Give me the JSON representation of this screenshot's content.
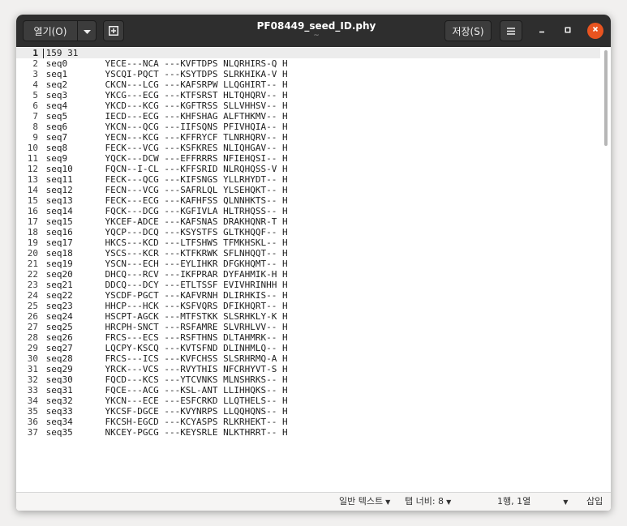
{
  "window": {
    "title": "PF08449_seed_ID.phy",
    "subtitle": "~"
  },
  "toolbar": {
    "open_label": "열기(O)",
    "open_arrow_icon": "chevron-down-icon",
    "new_tab_icon": "new-tab-icon",
    "save_label": "저장(S)",
    "menu_icon": "hamburger-menu-icon",
    "minimize_icon": "minimize-icon",
    "maximize_icon": "maximize-icon",
    "close_icon": "close-icon",
    "close_color": "#e95420"
  },
  "editor": {
    "current_line": 1,
    "lines": [
      {
        "num": "1",
        "text": "159 31"
      },
      {
        "num": "2",
        "text": "seq0       YECE---NCA ---KVFTDPS NLQRHIRS-Q H"
      },
      {
        "num": "3",
        "text": "seq1       YSCQI-PQCT ---KSYTDPS SLRKHIKA-V H"
      },
      {
        "num": "4",
        "text": "seq2       CKCN---LCG ---KAFSRPW LLQGHIRT-- H"
      },
      {
        "num": "5",
        "text": "seq3       YKCG---ECG ---KTFSRST HLTQHQRV-- H"
      },
      {
        "num": "6",
        "text": "seq4       YKCD---KCG ---KGFTRSS SLLVHHSV-- H"
      },
      {
        "num": "7",
        "text": "seq5       IECD---ECG ---KHFSHAG ALFTHKMV-- H"
      },
      {
        "num": "8",
        "text": "seq6       YKCN---QCG ---IIFSQNS PFIVHQIA-- H"
      },
      {
        "num": "9",
        "text": "seq7       YECN---KCG ---KFFRYCF TLNRHQRV-- H"
      },
      {
        "num": "10",
        "text": "seq8       FECK---VCG ---KSFKRES NLIQHGAV-- H"
      },
      {
        "num": "11",
        "text": "seq9       YQCK---DCW ---EFFRRRS NFIEHQSI-- H"
      },
      {
        "num": "12",
        "text": "seq10      FQCN--I-CL ---KFFSRID NLRQHQSS-V H"
      },
      {
        "num": "13",
        "text": "seq11      FECK---QCG ---KIFSNGS YLLRHYDT-- H"
      },
      {
        "num": "14",
        "text": "seq12      FECN---VCG ---SAFRLQL YLSEHQKT-- H"
      },
      {
        "num": "15",
        "text": "seq13      FECK---ECG ---KAFHFSS QLNNHKTS-- H"
      },
      {
        "num": "16",
        "text": "seq14      FQCK---DCG ---KGFIVLA HLTRHQSS-- H"
      },
      {
        "num": "17",
        "text": "seq15      YKCEF-ADCE ---KAFSNAS DRAKHQNR-T H"
      },
      {
        "num": "18",
        "text": "seq16      YQCP---DCQ ---KSYSTFS GLTKHQQF-- H"
      },
      {
        "num": "19",
        "text": "seq17      HKCS---KCD ---LTFSHWS TFMKHSKL-- H"
      },
      {
        "num": "20",
        "text": "seq18      YSCS---KCR ---KTFKRWK SFLNHQQT-- H"
      },
      {
        "num": "21",
        "text": "seq19      YSCN---ECH ---EYLIHKR DFGKHQMT-- H"
      },
      {
        "num": "22",
        "text": "seq20      DHCQ---RCV ---IKFPRAR DYFAHMIK-H H"
      },
      {
        "num": "23",
        "text": "seq21      DDCQ---DCY ---ETLTSSF EVIVHRINHH H"
      },
      {
        "num": "24",
        "text": "seq22      YSCDF-PGCT ---KAFVRNH DLIRHKIS-- H"
      },
      {
        "num": "25",
        "text": "seq23      HHCP---HCK ---KSFVQRS DFIKHQRT-- H"
      },
      {
        "num": "26",
        "text": "seq24      HSCPT-AGCK ---MTFSTKK SLSRHKLY-K H"
      },
      {
        "num": "27",
        "text": "seq25      HRCPH-SNCT ---RSFAMRE SLVRHLVV-- H"
      },
      {
        "num": "28",
        "text": "seq26      FRCS---ECS ---RSFTHNS DLTAHMRK-- H"
      },
      {
        "num": "29",
        "text": "seq27      LQCPY-KSCQ ---KVTSFND DLINHMLQ-- H"
      },
      {
        "num": "30",
        "text": "seq28      FRCS---ICS ---KVFCHSS SLSRHRMQ-A H"
      },
      {
        "num": "31",
        "text": "seq29      YRCK---VCS ---RVYTHIS NFCRHYVT-S H"
      },
      {
        "num": "32",
        "text": "seq30      FQCD---KCS ---YTCVNKS MLNSHRKS-- H"
      },
      {
        "num": "33",
        "text": "seq31      FQCE---ACG ---KSL-ANT LLIHHQKS-- H"
      },
      {
        "num": "34",
        "text": "seq32      YKCN---ECE ---ESFCRKD LLQTHELS-- H"
      },
      {
        "num": "35",
        "text": "seq33      YKCSF-DGCE ---KVYNRPS LLQQHQNS-- H"
      },
      {
        "num": "36",
        "text": "seq34      FKCSH-EGCD ---KCYASPS RLKRHEKT-- H"
      },
      {
        "num": "37",
        "text": "seq35      NKCEY-PGCG ---KEYSRLE NLKTHRRT-- H"
      }
    ]
  },
  "statusbar": {
    "language_label": "일반 텍스트",
    "tab_width_label": "탭 너비: 8",
    "position_label": "1행, 1열",
    "insert_mode_label": "삽입",
    "arrow_icon": "chevron-down-icon"
  }
}
